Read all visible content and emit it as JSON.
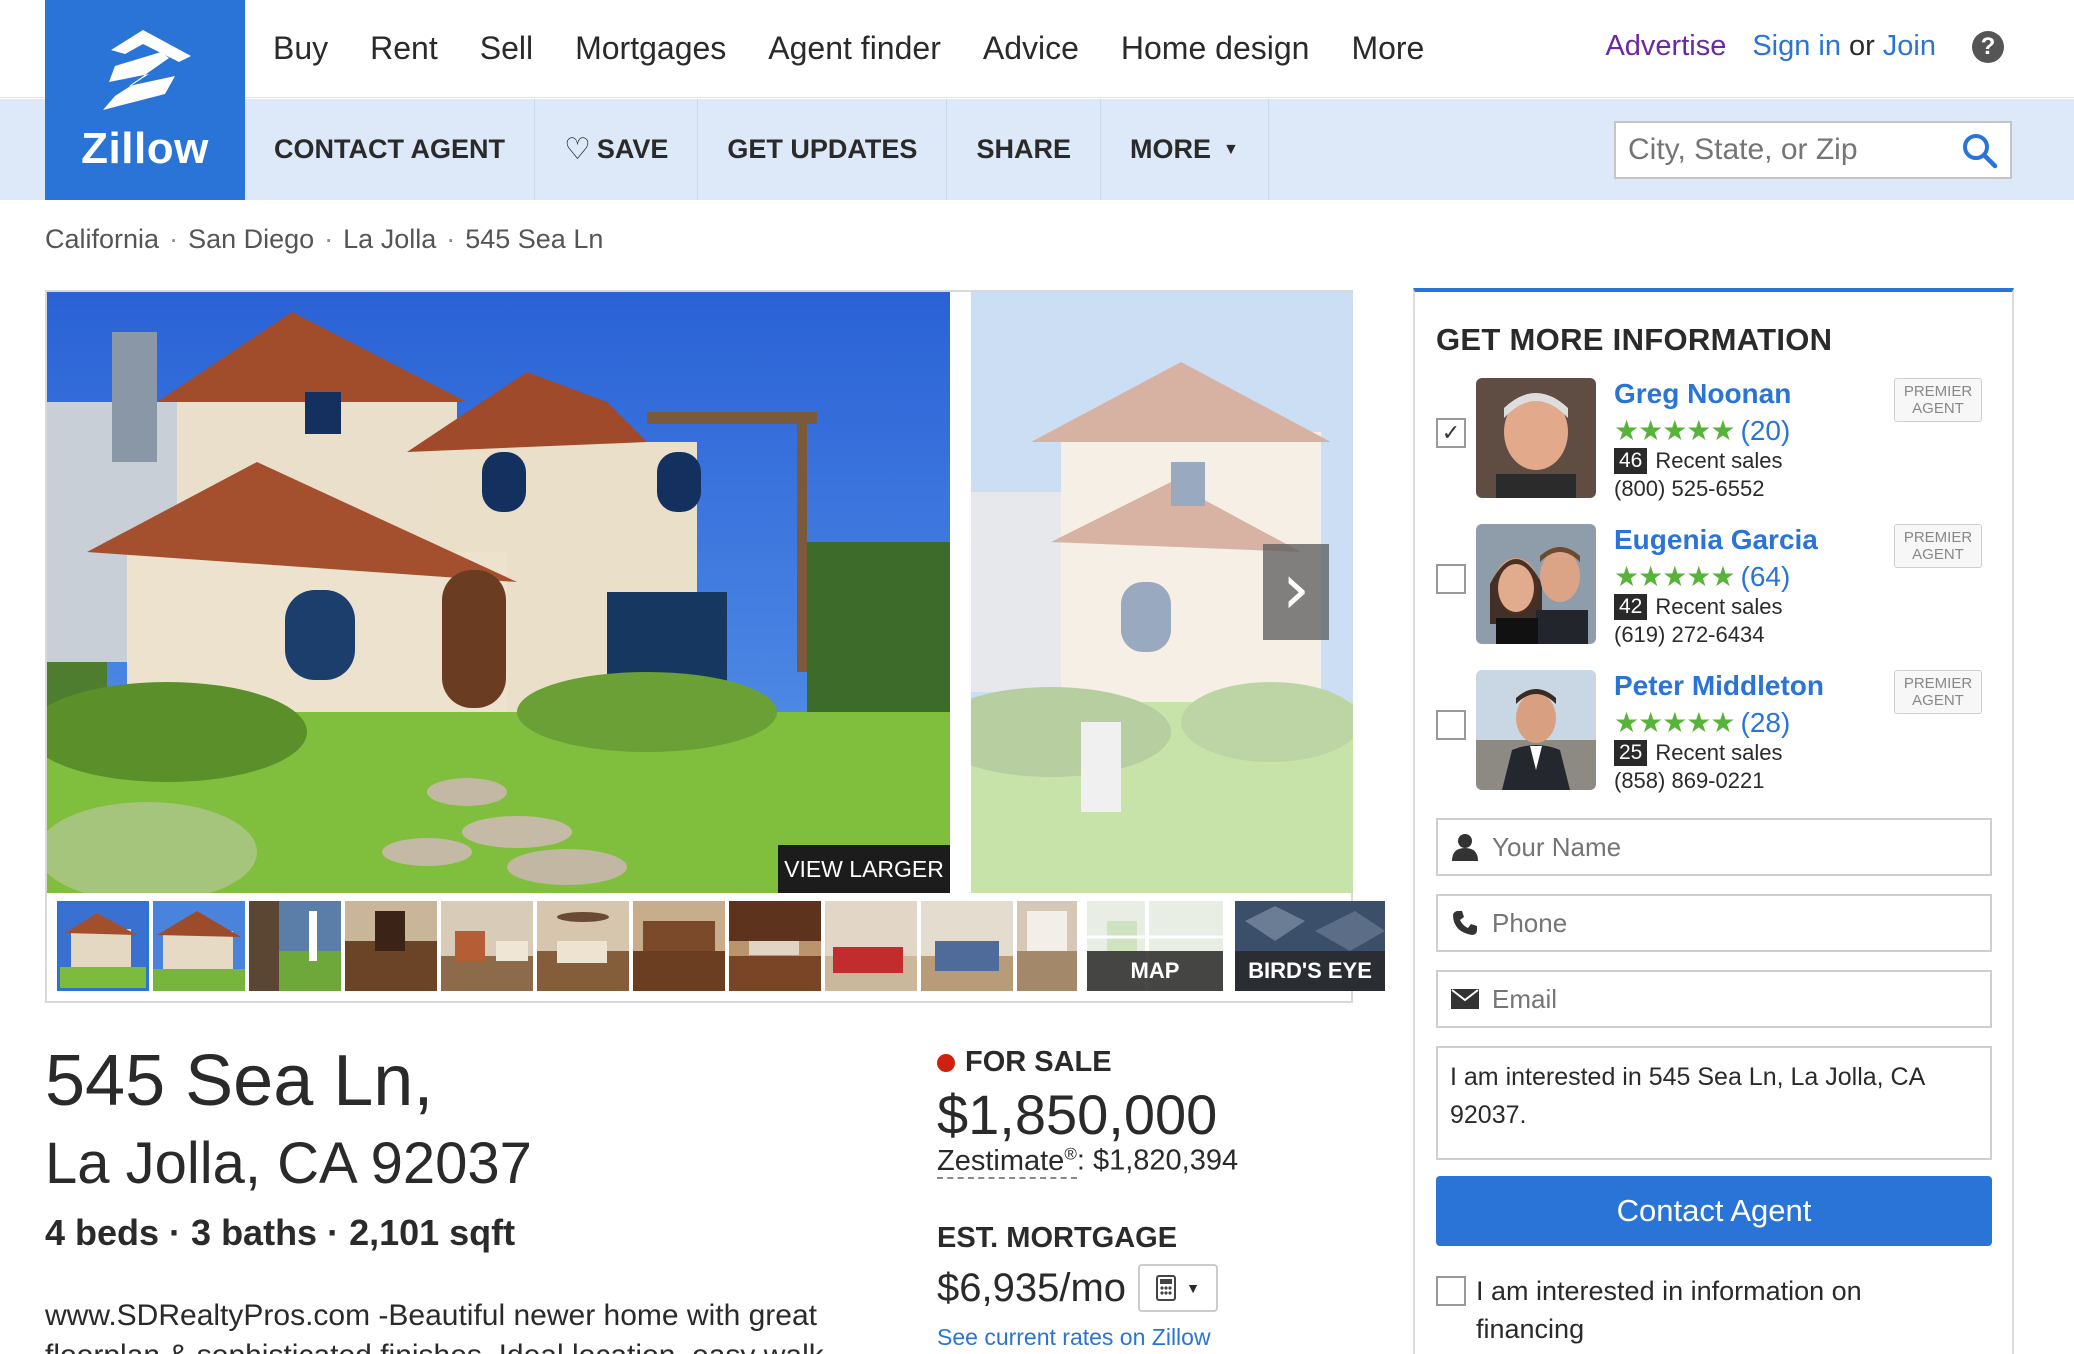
{
  "nav": {
    "logo_text": "Zillow",
    "links": [
      "Buy",
      "Rent",
      "Sell",
      "Mortgages",
      "Agent finder",
      "Advice",
      "Home design",
      "More"
    ],
    "advertise": "Advertise",
    "sign_in": "Sign in",
    "or": "or",
    "join": "Join",
    "help": "?"
  },
  "actions": {
    "contact": "CONTACT AGENT",
    "save": "SAVE",
    "updates": "GET UPDATES",
    "share": "SHARE",
    "more": "MORE"
  },
  "search": {
    "placeholder": "City, State, or Zip"
  },
  "breadcrumb": [
    "California",
    "San Diego",
    "La Jolla",
    "545 Sea Ln"
  ],
  "gallery": {
    "view_larger": "VIEW LARGER",
    "map_label": "MAP",
    "bird_label": "BIRD'S EYE"
  },
  "listing": {
    "address_line1": "545 Sea Ln,",
    "address_line2": "La Jolla, CA 92037",
    "specs": "4 beds · 3 baths · 2,101 sqft",
    "description": "www.SDRealtyPros.com -Beautiful newer home with great floorplan & sophisticated finishes. Ideal location, easy walk",
    "status": "FOR SALE",
    "price": "$1,850,000",
    "zestimate_label": "Zestimate",
    "zestimate_value": ": $1,820,394",
    "est_mortgage_label": "EST. MORTGAGE",
    "est_mortgage_value": "$6,935/mo",
    "rates_link": "See current rates on Zillow",
    "status_color": "#d0210e"
  },
  "contact": {
    "heading": "GET MORE INFORMATION",
    "premier_label_1": "PREMIER",
    "premier_label_2": "AGENT",
    "recent_sales_label": "Recent sales",
    "agents": [
      {
        "name": "Greg Noonan",
        "rating_count": "(20)",
        "recent_sales": "46",
        "phone": "(800) 525-6552",
        "checked": true
      },
      {
        "name": "Eugenia Garcia",
        "rating_count": "(64)",
        "recent_sales": "42",
        "phone": "(619) 272-6434",
        "checked": false
      },
      {
        "name": "Peter Middleton",
        "rating_count": "(28)",
        "recent_sales": "25",
        "phone": "(858) 869-0221",
        "checked": false
      }
    ],
    "name_placeholder": "Your Name",
    "phone_placeholder": "Phone",
    "email_placeholder": "Email",
    "message": "I am interested in 545 Sea Ln, La Jolla, CA 92037.",
    "button": "Contact Agent",
    "financing_text": "I am interested in information on financing"
  },
  "colors": {
    "brand": "#2a74d7",
    "action_bar": "#dde9f8",
    "stars": "#57b33a"
  }
}
